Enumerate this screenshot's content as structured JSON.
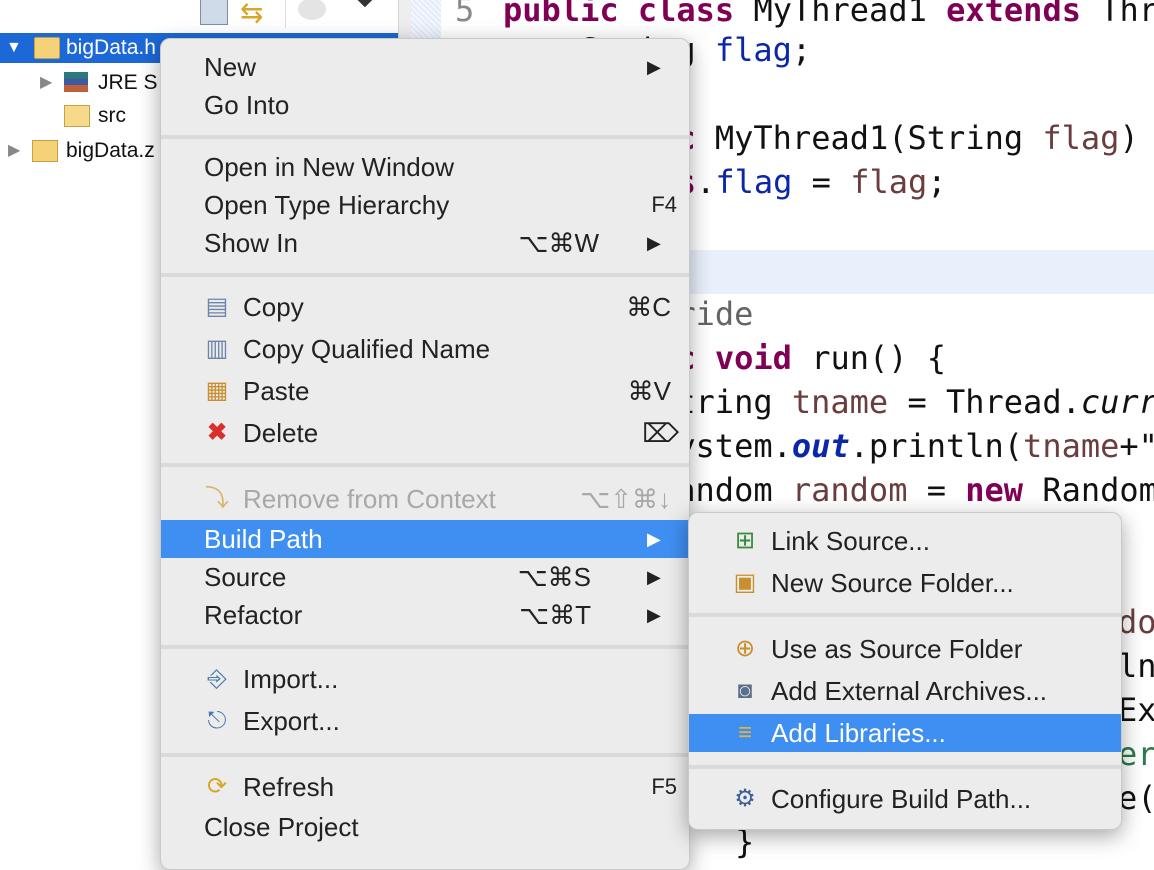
{
  "explorer": {
    "tree": [
      {
        "label": "bigData.h",
        "expanded": true,
        "selected": true,
        "icon": "java-project-folder-icon"
      },
      {
        "label": "JRE S",
        "expanded": false,
        "icon": "library-icon"
      },
      {
        "label": "src",
        "icon": "source-folder-icon"
      },
      {
        "label": "bigData.z",
        "expanded": false,
        "icon": "java-project-warning-icon"
      }
    ]
  },
  "editor": {
    "line_number": "5",
    "lines": {
      "l5": [
        "public",
        " ",
        "class",
        " MyThread1 ",
        "extends",
        " Thr"
      ],
      "l6": [
        "String ",
        "flag",
        ";"
      ],
      "l8": [
        "public",
        " MyThread1(String ",
        "flag",
        ")"
      ],
      "l9": [
        "this",
        ".",
        "flag",
        " = ",
        "flag",
        ";"
      ],
      "l12": "@Override",
      "l13": [
        "public",
        " ",
        "void",
        " run() {"
      ],
      "l14": [
        "String ",
        "tname",
        " = Thread.",
        "curr"
      ],
      "l15": [
        "System.",
        "out",
        ".println(",
        "tname",
        "+\""
      ],
      "l16": [
        "Random ",
        "random",
        " = ",
        "new",
        " Random"
      ],
      "l17": "do",
      "l18": "ln",
      "l19": "Ex",
      "l20": "er",
      "l21": "e(",
      "l22": "}"
    }
  },
  "context_menu": {
    "items": [
      {
        "label": "New",
        "submenu": true
      },
      {
        "label": "Go Into"
      },
      {
        "label": "Open in New Window"
      },
      {
        "label": "Open Type Hierarchy",
        "shortcut": "F4"
      },
      {
        "label": "Show In",
        "shortcut": "⌥⌘W",
        "submenu": true
      },
      {
        "label": "Copy",
        "shortcut": "⌘C",
        "icon": "copy-icon"
      },
      {
        "label": "Copy Qualified Name",
        "icon": "copy-qualified-name-icon"
      },
      {
        "label": "Paste",
        "shortcut": "⌘V",
        "icon": "paste-icon"
      },
      {
        "label": "Delete",
        "shortcut": "⌦",
        "icon": "delete-icon"
      },
      {
        "label": "Remove from Context",
        "shortcut": "⌥⇧⌘↓",
        "disabled": true,
        "icon": "remove-context-icon"
      },
      {
        "label": "Build Path",
        "submenu": true,
        "highlighted": true
      },
      {
        "label": "Source",
        "shortcut": "⌥⌘S",
        "submenu": true
      },
      {
        "label": "Refactor",
        "shortcut": "⌥⌘T",
        "submenu": true
      },
      {
        "label": "Import...",
        "icon": "import-icon"
      },
      {
        "label": "Export...",
        "icon": "export-icon"
      },
      {
        "label": "Refresh",
        "shortcut": "F5",
        "icon": "refresh-icon"
      },
      {
        "label": "Close Project"
      }
    ],
    "submenu_arrow": "▶"
  },
  "build_path_submenu": {
    "items": [
      {
        "label": "Link Source...",
        "icon": "link-source-icon"
      },
      {
        "label": "New Source Folder...",
        "icon": "new-source-folder-icon"
      },
      {
        "label": "Use as Source Folder",
        "icon": "use-as-source-folder-icon"
      },
      {
        "label": "Add External Archives...",
        "icon": "jar-archive-icon"
      },
      {
        "label": "Add Libraries...",
        "icon": "library-icon",
        "highlighted": true
      },
      {
        "label": "Configure Build Path...",
        "icon": "configure-build-path-icon"
      }
    ]
  },
  "colors": {
    "selection": "#1c68d6",
    "menu_highlight": "#3f8ff2",
    "keyword": "#7f0055",
    "field": "#0b26a8",
    "variable": "#6a3e3e"
  }
}
